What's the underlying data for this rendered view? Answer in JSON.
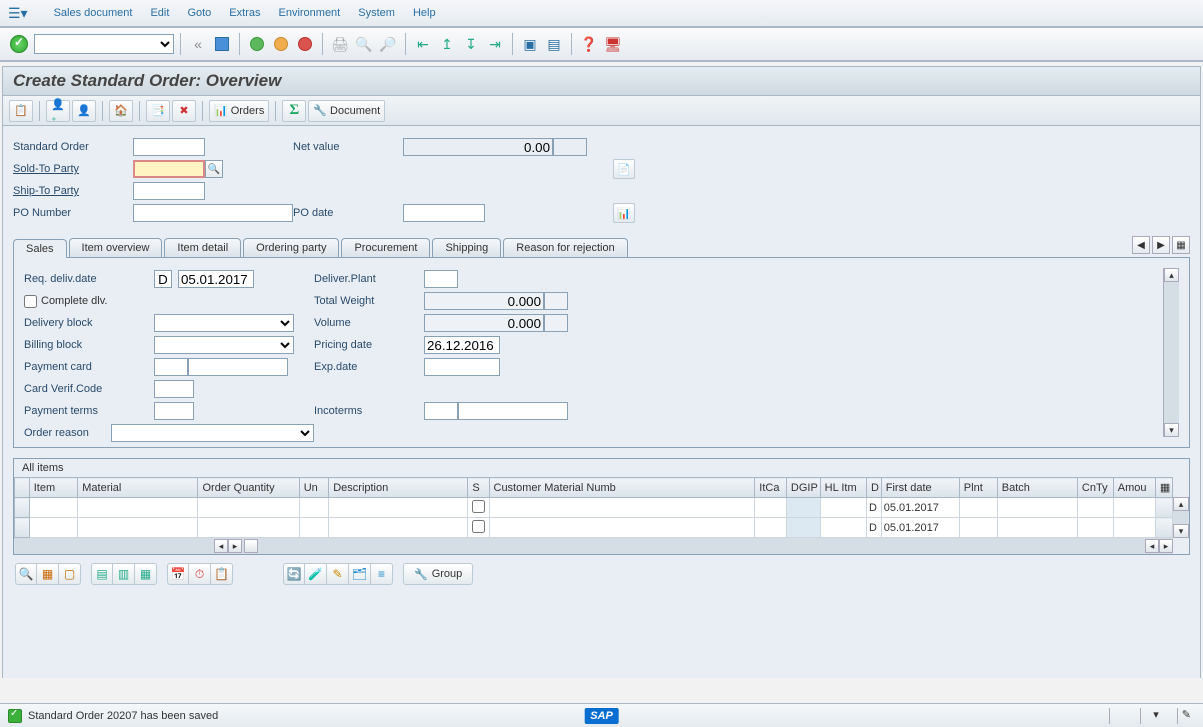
{
  "menu": {
    "items": [
      "Sales document",
      "Edit",
      "Goto",
      "Extras",
      "Environment",
      "System",
      "Help"
    ]
  },
  "toolbar": {
    "command_value": ""
  },
  "title": "Create Standard Order: Overview",
  "apptoolbar": {
    "orders_label": "Orders",
    "document_label": "Document"
  },
  "header": {
    "standard_order_label": "Standard Order",
    "standard_order_value": "",
    "net_value_label": "Net value",
    "net_value": "0.00",
    "currency": "",
    "sold_to_label": "Sold-To Party",
    "sold_to_value": "",
    "ship_to_label": "Ship-To Party",
    "ship_to_value": "",
    "po_number_label": "PO Number",
    "po_number_value": "",
    "po_date_label": "PO date",
    "po_date_value": ""
  },
  "tabs": [
    "Sales",
    "Item overview",
    "Item detail",
    "Ordering party",
    "Procurement",
    "Shipping",
    "Reason for rejection"
  ],
  "active_tab_index": 0,
  "sales_tab": {
    "req_deliv_label": "Req. deliv.date",
    "req_deliv_type": "D",
    "req_deliv_date": "05.01.2017",
    "deliver_plant_label": "Deliver.Plant",
    "deliver_plant": "",
    "complete_dlv_label": "Complete dlv.",
    "complete_dlv": false,
    "total_weight_label": "Total Weight",
    "total_weight": "0.000",
    "total_weight_unit": "",
    "delivery_block_label": "Delivery block",
    "delivery_block": "",
    "volume_label": "Volume",
    "volume": "0.000",
    "volume_unit": "",
    "billing_block_label": "Billing block",
    "billing_block": "",
    "pricing_date_label": "Pricing date",
    "pricing_date": "26.12.2016",
    "payment_card_label": "Payment card",
    "payment_card_type": "",
    "payment_card_num": "",
    "exp_date_label": "Exp.date",
    "exp_date": "",
    "card_verif_label": "Card Verif.Code",
    "card_verif": "",
    "payment_terms_label": "Payment terms",
    "payment_terms": "",
    "incoterms_label": "Incoterms",
    "incoterms1": "",
    "incoterms2": "",
    "order_reason_label": "Order reason",
    "order_reason": ""
  },
  "items": {
    "panel_title": "All items",
    "columns": [
      "Item",
      "Material",
      "Order Quantity",
      "Un",
      "Description",
      "S",
      "Customer Material Numb",
      "ItCa",
      "DGIP",
      "HL Itm",
      "D",
      "First date",
      "Plnt",
      "Batch",
      "CnTy",
      "Amou"
    ],
    "rows": [
      {
        "d": "D",
        "first_date": "05.01.2017"
      },
      {
        "d": "D",
        "first_date": "05.01.2017"
      }
    ]
  },
  "bottom_toolbar": {
    "group_label": "Group"
  },
  "status": {
    "message": "Standard Order 20207 has been saved"
  }
}
